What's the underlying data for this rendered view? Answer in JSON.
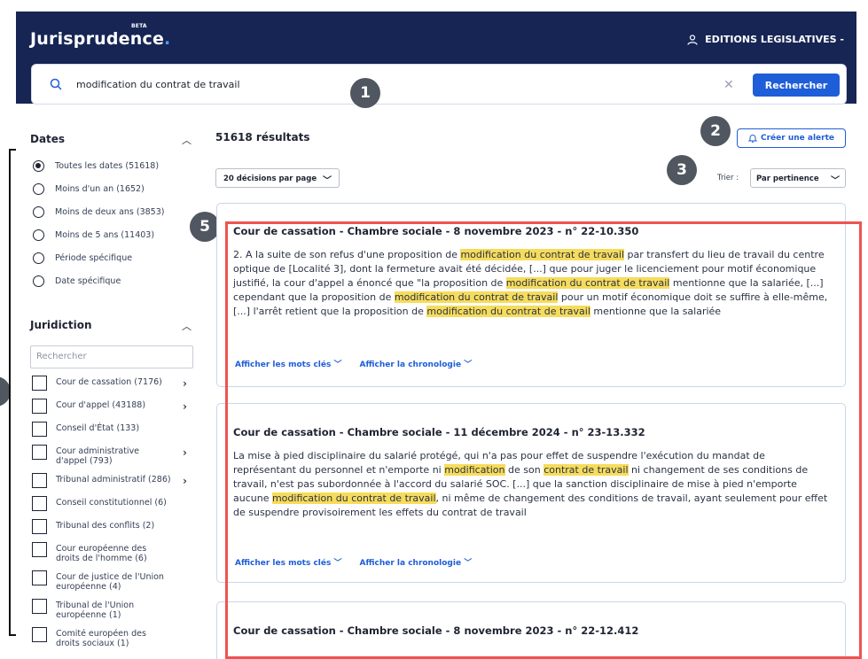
{
  "header": {
    "brand": "Jurisprudence",
    "brand_dot": ".",
    "beta": "BETA",
    "account": "EDITIONS LEGISLATIVES -"
  },
  "search": {
    "query": "modification du contrat de travail",
    "button": "Rechercher"
  },
  "badges": [
    "1",
    "2",
    "3",
    "5"
  ],
  "filters": {
    "dates_title": "Dates",
    "dates": [
      "Toutes les dates (51618)",
      "Moins d'un an (1652)",
      "Moins de deux ans (3853)",
      "Moins de 5 ans (11403)",
      "Période spécifique",
      "Date spécifique"
    ],
    "juridiction_title": "Juridiction",
    "juridiction_search_placeholder": "Rechercher",
    "juridictions": [
      "Cour de cassation (7176)",
      "Cour d'appel (43188)",
      "Conseil d'État (133)",
      "Cour administrative d'appel (793)",
      "Tribunal administratif (286)",
      "Conseil constitutionnel (6)",
      "Tribunal des conflits (2)",
      "Cour européenne des droits de l'homme (6)",
      "Cour de justice de l'Union européenne (4)",
      "Tribunal de l'Union européenne (1)",
      "Comité européen des droits sociaux (1)"
    ]
  },
  "results": {
    "count": "51618 résultats",
    "alert": "Créer une alerte",
    "per_page": "20 décisions par page",
    "sort_label": "Trier :",
    "sort_value": "Par pertinence",
    "show_keywords": "Afficher les mots clés",
    "show_chronology": "Afficher la chronologie",
    "cards": [
      {
        "title": "Cour de cassation - Chambre sociale - 8 novembre 2023 - n° 22-10.350",
        "segments": [
          {
            "t": "2. A la suite de son refus d'une proposition de ",
            "h": false
          },
          {
            "t": "modification du contrat de travail",
            "h": true
          },
          {
            "t": " par transfert du lieu de travail du centre optique de [Localité 3], dont la fermeture avait été décidée, [...] que pour juger le licenciement pour motif économique justifié, la cour d'appel a énoncé que \"la proposition de ",
            "h": false
          },
          {
            "t": "modification du contrat de travail",
            "h": true
          },
          {
            "t": " mentionne que la salariée, [...] cependant que la proposition de ",
            "h": false
          },
          {
            "t": "modification du contrat de travail",
            "h": true
          },
          {
            "t": " pour un motif économique doit se suffire à elle-même, [...] l'arrêt retient que la proposition de ",
            "h": false
          },
          {
            "t": "modification du contrat de travail",
            "h": true
          },
          {
            "t": " mentionne que la salariée",
            "h": false
          }
        ]
      },
      {
        "title": "Cour de cassation - Chambre sociale - 11 décembre 2024 - n° 23-13.332",
        "segments": [
          {
            "t": "La mise à pied disciplinaire du salarié protégé, qui n'a pas pour effet de suspendre l'exécution du mandat de représentant du personnel et n'emporte ni ",
            "h": false
          },
          {
            "t": "modification",
            "h": true
          },
          {
            "t": " de son ",
            "h": false
          },
          {
            "t": "contrat de travail",
            "h": true
          },
          {
            "t": " ni changement de ses conditions de travail, n'est pas subordonnée à l'accord du salarié SOC. [...] que la sanction disciplinaire de mise à pied n'emporte aucune ",
            "h": false
          },
          {
            "t": "modification du contrat de travail",
            "h": true
          },
          {
            "t": ", ni même de changement des conditions de travail, ayant seulement pour effet de suspendre provisoirement les effets du contrat de travail",
            "h": false
          }
        ]
      },
      {
        "title": "Cour de cassation - Chambre sociale - 8 novembre 2023 - n° 22-12.412",
        "segments": []
      }
    ]
  }
}
